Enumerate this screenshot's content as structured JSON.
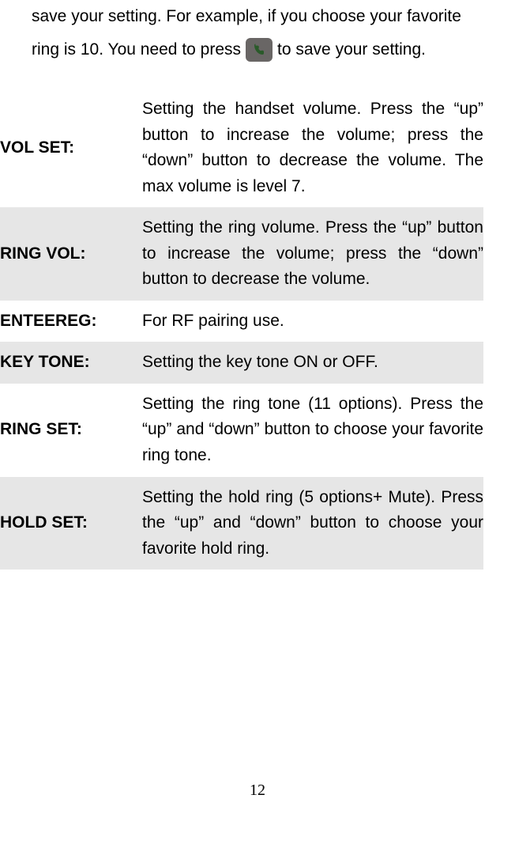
{
  "intro": {
    "line1": "save your setting. For example, if you choose your favorite",
    "line2a": "ring is 10. You need to press",
    "line2b": " to save your setting.",
    "icon_name": "phone-icon"
  },
  "table": [
    {
      "label": "VOL SET:",
      "desc": "Setting the handset volume. Press the “up” button to increase the volume; press the “down” button to decrease the volume. The max volume is level 7.",
      "shaded": false
    },
    {
      "label": "RING VOL:",
      "desc": "Setting the ring volume. Press the “up” button to increase the volume; press the “down” button to decrease the volume.",
      "shaded": true
    },
    {
      "label": "ENTEEREG:",
      "desc": "For RF pairing use.",
      "shaded": false
    },
    {
      "label": "KEY TONE:",
      "desc": "Setting the key tone ON or OFF.",
      "shaded": true
    },
    {
      "label": "RING SET:",
      "desc": "Setting the ring tone (11 options). Press the “up” and “down” button to choose your favorite ring tone.",
      "shaded": false
    },
    {
      "label": "HOLD SET:",
      "desc": "Setting the hold ring (5 options+ Mute). Press the “up” and “down” button to choose your favorite hold ring.",
      "shaded": true
    }
  ],
  "page_number": "12"
}
